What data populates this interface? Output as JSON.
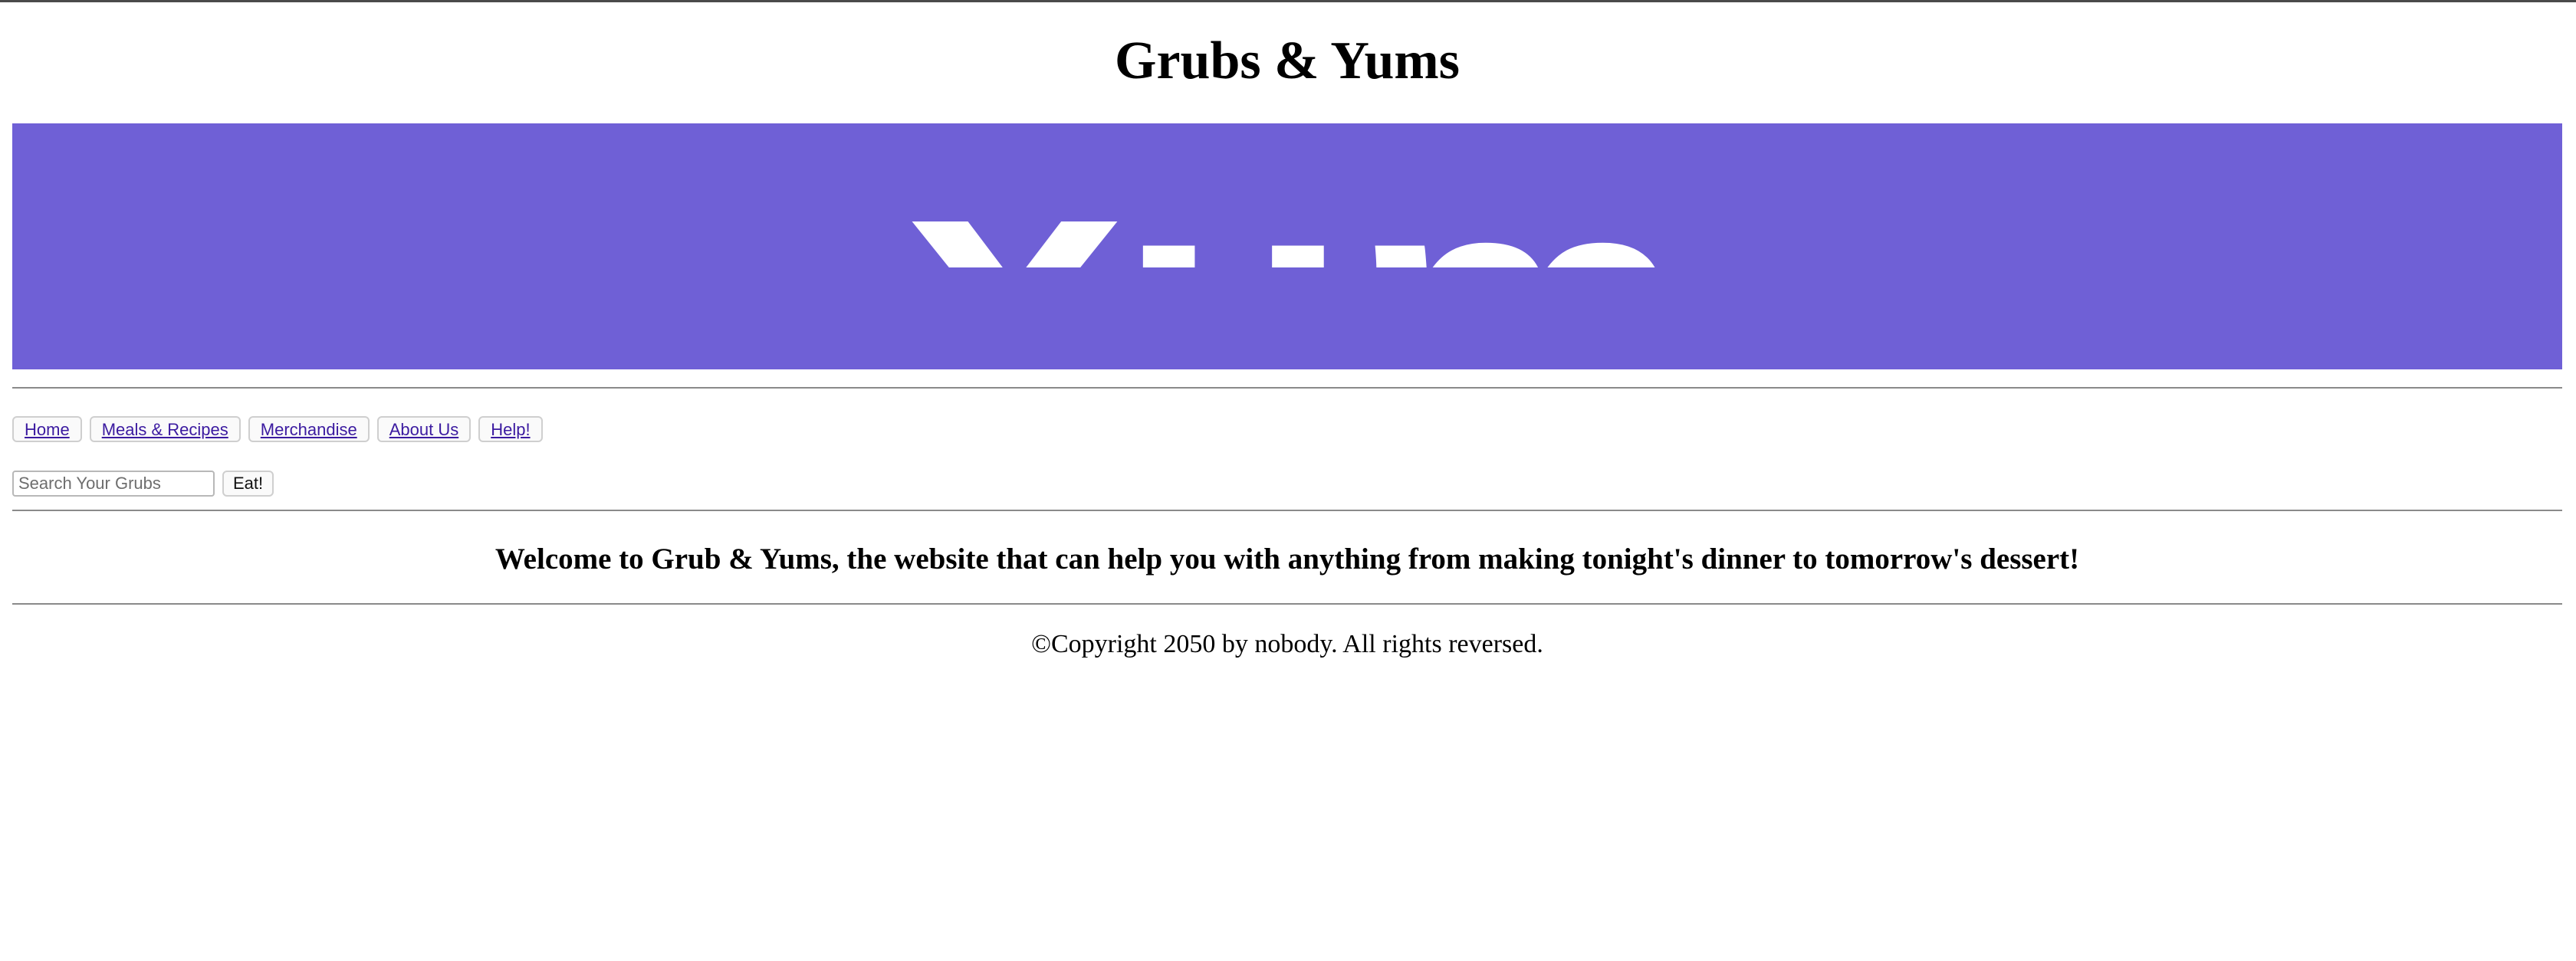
{
  "header": {
    "title": "Grubs & Yums"
  },
  "banner": {
    "text": "Yum",
    "background_color": "#6f60d6",
    "text_color": "#ffffff"
  },
  "nav": {
    "items": [
      {
        "label": "Home"
      },
      {
        "label": "Meals & Recipes"
      },
      {
        "label": "Merchandise"
      },
      {
        "label": "About Us"
      },
      {
        "label": "Help!"
      }
    ]
  },
  "search": {
    "placeholder": "Search Your Grubs",
    "value": "",
    "button_label": "Eat!"
  },
  "main": {
    "welcome": "Welcome to Grub & Yums, the website that can help you with anything from making tonight's dinner to tomorrow's dessert!"
  },
  "footer": {
    "copyright": "©Copyright 2050 by nobody. All rights reversed."
  }
}
